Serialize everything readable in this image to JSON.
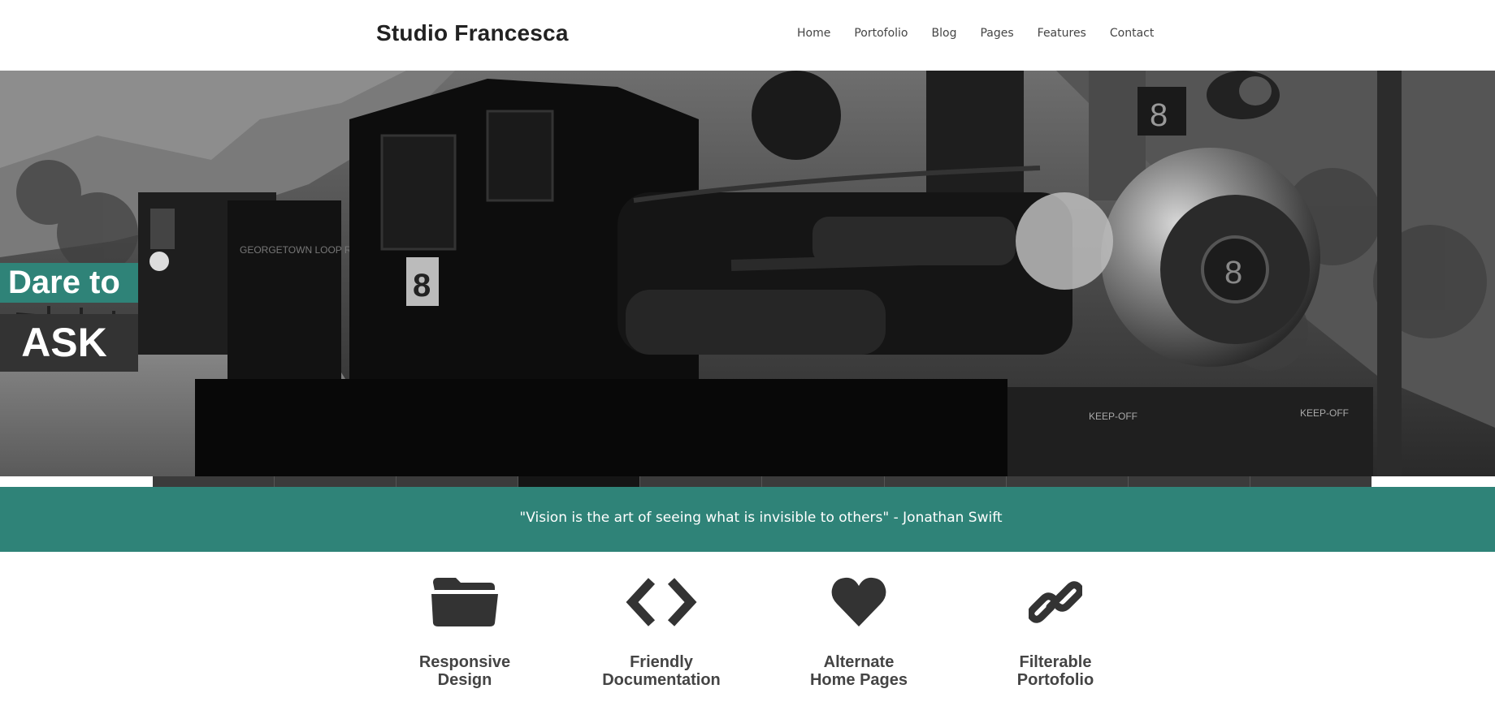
{
  "header": {
    "brand": "Studio Francesca",
    "nav": [
      "Home",
      "Portofolio",
      "Blog",
      "Pages",
      "Features",
      "Contact"
    ]
  },
  "hero": {
    "caption_line1": "Dare to",
    "caption_line2": "ASK",
    "slide_count": 10,
    "active_slide": 4
  },
  "quote": {
    "text": "\"Vision is the art of seeing what is invisible to others\" - Jonathan Swift"
  },
  "features": [
    {
      "icon": "folder-icon",
      "title_line1": "Responsive",
      "title_line2": "Design"
    },
    {
      "icon": "code-icon",
      "title_line1": "Friendly",
      "title_line2": "Documentation"
    },
    {
      "icon": "heart-icon",
      "title_line1": "Alternate",
      "title_line2": "Home Pages"
    },
    {
      "icon": "link-icon",
      "title_line1": "Filterable",
      "title_line2": "Portofolio"
    }
  ],
  "colors": {
    "accent": "#2f8378",
    "dark": "#333333",
    "text": "#444444"
  }
}
